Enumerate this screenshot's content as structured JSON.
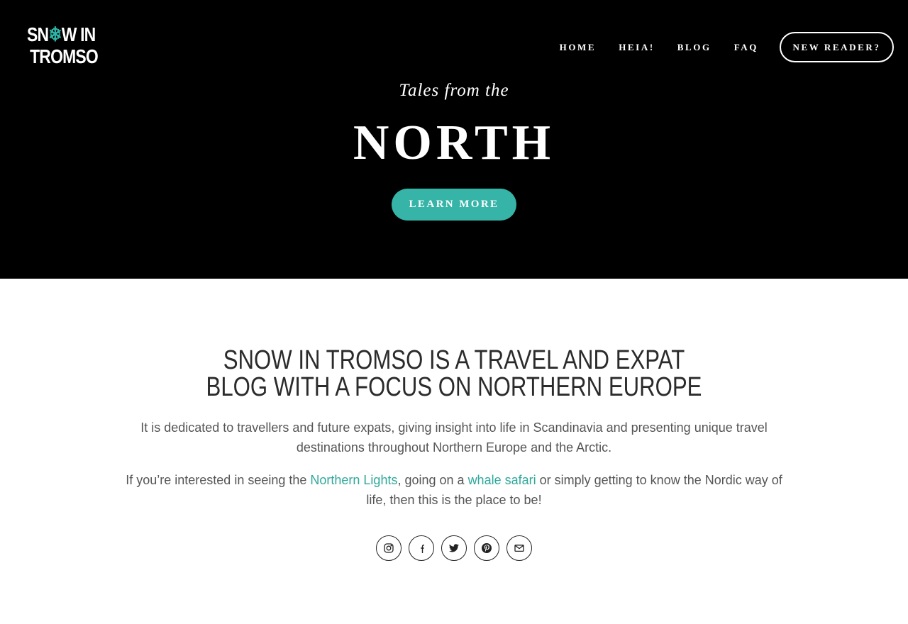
{
  "brand": {
    "logo_line1_a": "SN",
    "logo_snowflake": "❄",
    "logo_line1_b": "W IN",
    "logo_line2": "TROMSO",
    "accent_color": "#36b4a8"
  },
  "nav": {
    "items": [
      "HOME",
      "HEIA!",
      "BLOG",
      "FAQ"
    ],
    "cta": "NEW READER?"
  },
  "hero": {
    "tagline": "Tales from the",
    "headline": "NORTH",
    "button": "LEARN MORE"
  },
  "about": {
    "title": "SNOW IN TROMSO IS A TRAVEL AND EXPAT BLOG WITH A FOCUS ON NORTHERN EUROPE",
    "paragraph1": "It is dedicated to travellers and future expats, giving insight into life in Scandinavia and presenting unique travel destinations throughout Northern Europe and the Arctic.",
    "paragraph2_part1": "If you’re interested in seeing the ",
    "link_northern_lights": "Northern Lights",
    "paragraph2_part2": ", going on a ",
    "link_whale_safari": "whale safari",
    "paragraph2_part3": " or simply getting to know the Nordic way of life, then this is the place to be!"
  },
  "socials": [
    "instagram-icon",
    "facebook-icon",
    "twitter-icon",
    "pinterest-icon",
    "email-icon"
  ]
}
